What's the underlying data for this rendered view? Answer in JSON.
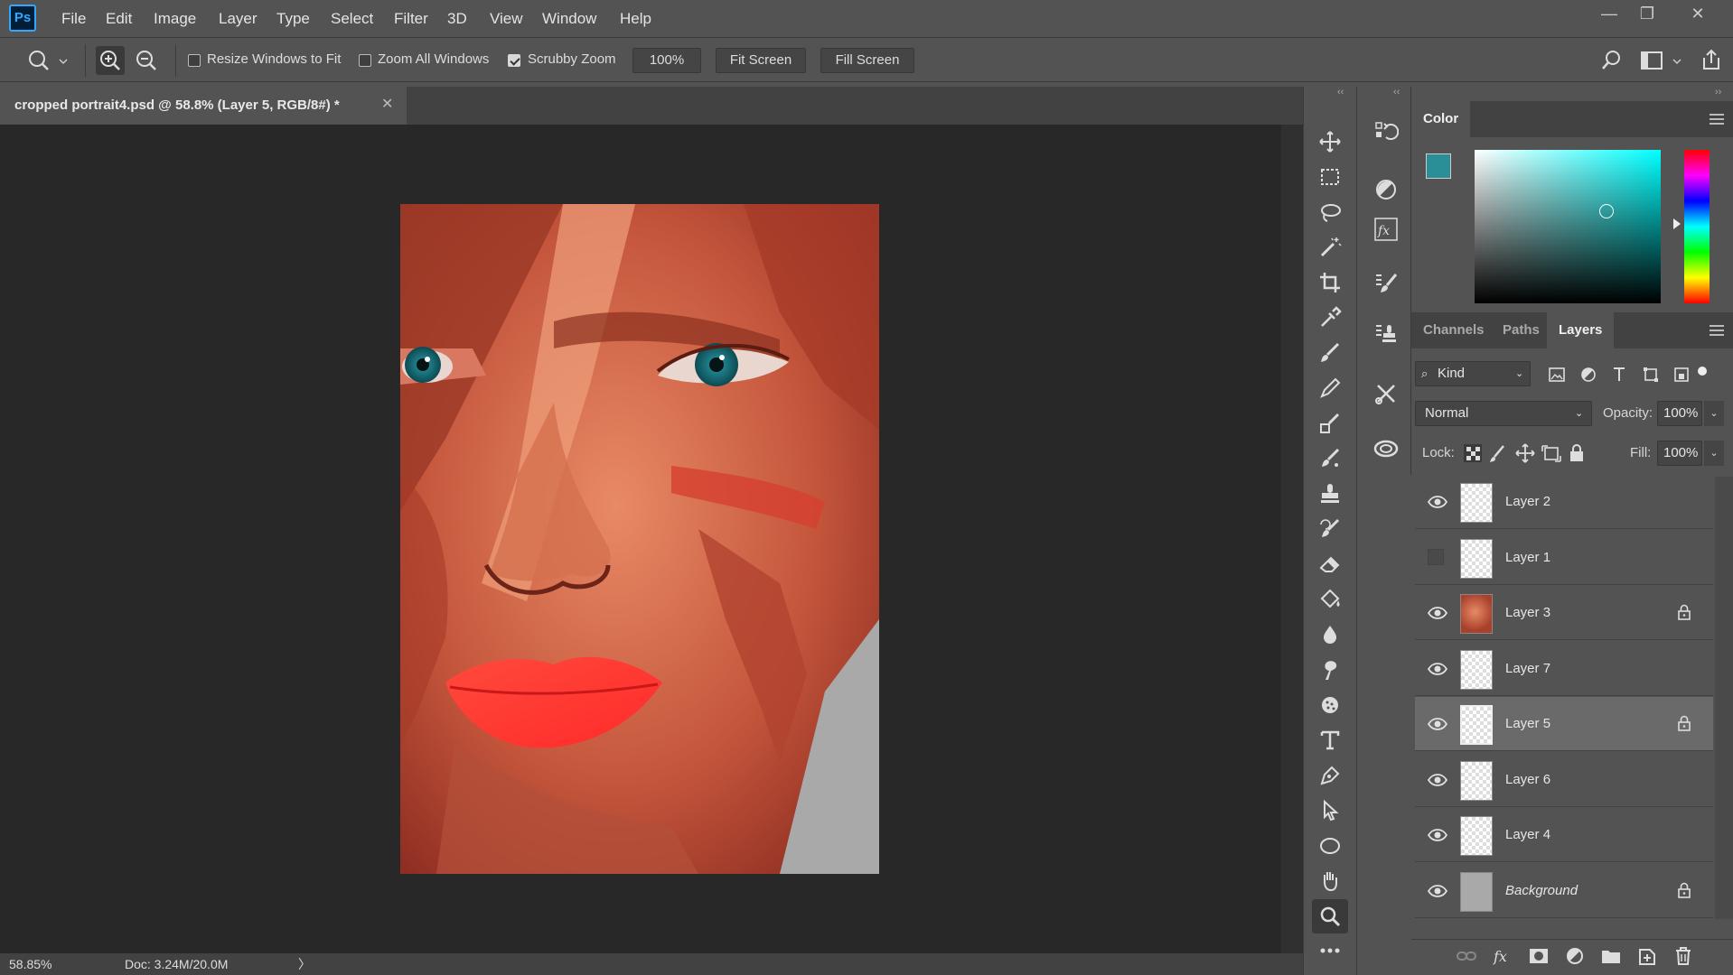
{
  "app": {
    "logo_text": "Ps"
  },
  "menu": [
    "File",
    "Edit",
    "Image",
    "Layer",
    "Type",
    "Select",
    "Filter",
    "3D",
    "View",
    "Window",
    "Help"
  ],
  "window_controls": {
    "minimize": "—",
    "restore": "❐",
    "close": "✕"
  },
  "options": {
    "resize_windows": "Resize Windows to Fit",
    "zoom_all": "Zoom All Windows",
    "scrubby_zoom": "Scrubby Zoom",
    "zoom_value": "100%",
    "fit_screen": "Fit Screen",
    "fill_screen": "Fill Screen"
  },
  "document": {
    "tab_title": "cropped portrait4.psd @ 58.8% (Layer 5, RGB/8#) *",
    "close": "✕"
  },
  "status": {
    "zoom": "58.85%",
    "doc": "Doc: 3.24M/20.0M",
    "arrow": "〉"
  },
  "colors": {
    "foreground": "#2a8f96",
    "background": "#111111",
    "accent": "#31a8ff"
  },
  "color_panel": {
    "title": "Color"
  },
  "layers_panel": {
    "tabs": [
      "Channels",
      "Paths",
      "Layers"
    ],
    "filter_kind": "Kind",
    "blend_mode": "Normal",
    "opacity_label": "Opacity:",
    "opacity_value": "100%",
    "lock_label": "Lock:",
    "fill_label": "Fill:",
    "fill_value": "100%",
    "layers": [
      {
        "name": "Layer 2",
        "visible": true,
        "locked": false,
        "thumb": "transparent"
      },
      {
        "name": "Layer 1",
        "visible": false,
        "locked": false,
        "thumb": "transparent"
      },
      {
        "name": "Layer 3",
        "visible": true,
        "locked": true,
        "thumb": "portrait"
      },
      {
        "name": "Layer 7",
        "visible": true,
        "locked": false,
        "thumb": "transparent"
      },
      {
        "name": "Layer 5",
        "visible": true,
        "locked": true,
        "thumb": "transparent",
        "selected": true
      },
      {
        "name": "Layer 6",
        "visible": true,
        "locked": false,
        "thumb": "transparent"
      },
      {
        "name": "Layer 4",
        "visible": true,
        "locked": false,
        "thumb": "transparent"
      },
      {
        "name": "Background",
        "visible": true,
        "locked": true,
        "thumb": "gray",
        "italic": true
      }
    ]
  },
  "tools": [
    "move-tool",
    "marquee-tool",
    "lasso-tool",
    "magic-wand-tool",
    "crop-tool",
    "eyedropper-tool",
    "brush-tool",
    "pencil-tool",
    "spot-healing-tool",
    "mixer-brush-tool",
    "clone-stamp-tool",
    "history-brush-tool",
    "eraser-tool",
    "paint-bucket-tool",
    "blur-tool",
    "smudge-tool",
    "sponge-tool",
    "type-tool",
    "pen-tool",
    "path-selection-tool",
    "ellipse-tool",
    "hand-tool",
    "zoom-tool",
    "more-tools"
  ]
}
